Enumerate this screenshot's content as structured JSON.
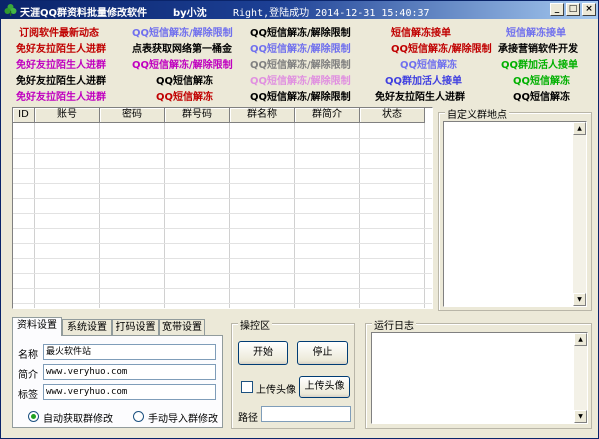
{
  "window": {
    "title": "天涯QQ群资料批量修改软件",
    "author": "by小沈",
    "status": "Right,登陆成功 2014-12-31 15:40:37",
    "controls": {
      "minimize": "_",
      "maximize": "□",
      "close": "×"
    }
  },
  "links": [
    {
      "text": "订阅软件最新动态",
      "color": "#c00000"
    },
    {
      "text": "QQ短信解冻/解除限制",
      "color": "#7070ee"
    },
    {
      "text": "QQ短信解冻/解除限制",
      "color": "#000000"
    },
    {
      "text": "短信解冻接单",
      "color": "#c00000"
    },
    {
      "text": "短信解冻接单",
      "color": "#7070ee"
    },
    {
      "text": "免好友拉陌生人进群",
      "color": "#c00000"
    },
    {
      "text": "点表获取网络第一桶金",
      "color": "#000000"
    },
    {
      "text": "QQ短信解冻/解除限制",
      "color": "#7070ee"
    },
    {
      "text": "QQ短信解冻/解除限制",
      "color": "#c00000"
    },
    {
      "text": "承接营销软件开发",
      "color": "#000000"
    },
    {
      "text": "承接营销软件开发",
      "color": "#000000"
    },
    {
      "text": "免好友拉陌生人进群",
      "color": "#c000c0"
    },
    {
      "text": "QQ短信解冻/解除限制",
      "color": "#c000c0"
    },
    {
      "text": "QQ短信解冻/解除限制",
      "color": "#808080"
    },
    {
      "text": "QQ短信解冻",
      "color": "#7070ee"
    },
    {
      "text": "QQ群加活人接单",
      "color": "#00b000"
    },
    {
      "text": "免好友拉陌生人进群",
      "color": "#000000"
    },
    {
      "text": "QQ短信解冻",
      "color": "#000000"
    },
    {
      "text": "QQ短信解冻/解除限制",
      "color": "#e090e0"
    },
    {
      "text": "QQ群加活人接单",
      "color": "#4040e0"
    },
    {
      "text": "QQ短信解冻",
      "color": "#00b000"
    },
    {
      "text": "免好友拉陌生人进群",
      "color": "#c000c0"
    },
    {
      "text": "QQ短信解冻",
      "color": "#c00000"
    },
    {
      "text": "QQ短信解冻/解除限制",
      "color": "#000000"
    },
    {
      "text": "免好友拉陌生人进群",
      "color": "#000000"
    },
    {
      "text": "QQ短信解冻",
      "color": "#000000"
    }
  ],
  "grid": {
    "columns": [
      "ID",
      "账号",
      "密码",
      "群号码",
      "群名称",
      "群简介",
      "状态"
    ]
  },
  "custom_points": {
    "title": "自定义群地点"
  },
  "tabs": [
    "资料设置",
    "系统设置",
    "打码设置",
    "宽带设置"
  ],
  "profile": {
    "name_label": "名称",
    "name_value": "最火软件站",
    "intro_label": "简介",
    "intro_value": "www.veryhuo.com",
    "tag_label": "标签",
    "tag_value": "www.veryhuo.com",
    "radio_auto": "自动获取群修改",
    "radio_manual": "手动导入群修改"
  },
  "operation": {
    "title": "操控区",
    "start": "开始",
    "stop": "停止",
    "upload_check": "上传头像",
    "upload_button": "上传头像",
    "path_label": "路径"
  },
  "log": {
    "title": "运行日志"
  }
}
